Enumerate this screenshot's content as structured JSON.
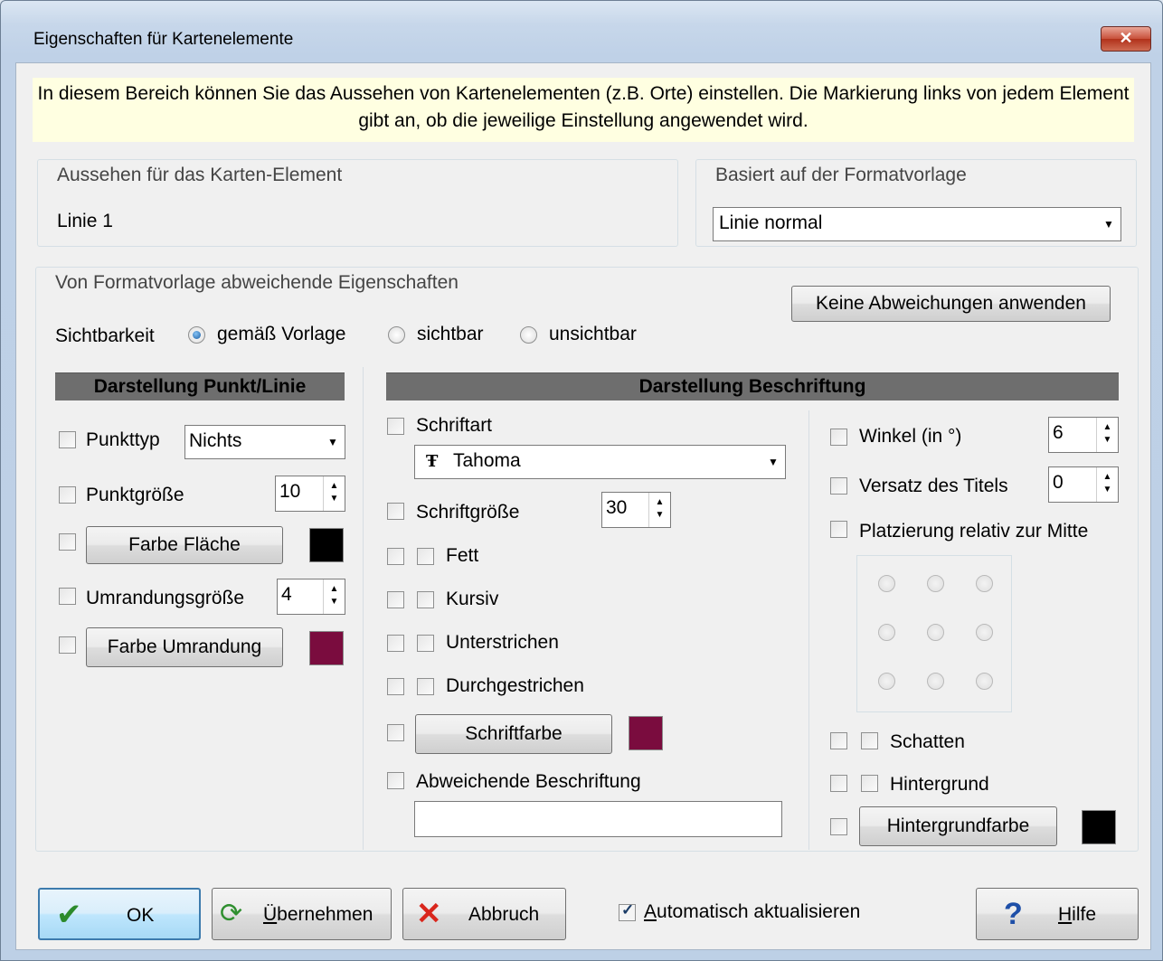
{
  "window": {
    "title": "Eigenschaften für Kartenelemente",
    "close_glyph": "✕"
  },
  "info_text": "In diesem Bereich können Sie das Aussehen von Kartenelementen (z.B. Orte) einstellen. Die Markierung links von jedem Element gibt an, ob die jeweilige Einstellung angewendet wird.",
  "appearance": {
    "group_title": "Aussehen für das Karten-Element",
    "element_name": "Linie 1"
  },
  "template": {
    "group_title": "Basiert auf der Formatvorlage",
    "selected": "Linie normal"
  },
  "deviating": {
    "group_title": "Von Formatvorlage abweichende Eigenschaften",
    "reset_button": "Keine Abweichungen anwenden",
    "visibility_label": "Sichtbarkeit",
    "visibility_options": [
      "gemäß Vorlage",
      "sichtbar",
      "unsichtbar"
    ],
    "visibility_selected": "gemäß Vorlage"
  },
  "point_line": {
    "header": "Darstellung Punkt/Linie",
    "point_type_label": "Punkttyp",
    "point_type_value": "Nichts",
    "point_size_label": "Punktgröße",
    "point_size_value": "10",
    "fill_color_button": "Farbe Fläche",
    "fill_color": "#000000",
    "border_size_label": "Umrandungsgröße",
    "border_size_value": "4",
    "border_color_button": "Farbe Umrandung",
    "border_color": "#7a0c3e"
  },
  "label": {
    "header": "Darstellung Beschriftung",
    "font_label": "Schriftart",
    "font_icon": "Ŧ",
    "font_value": "Tahoma",
    "font_size_label": "Schriftgröße",
    "font_size_value": "30",
    "bold": "Fett",
    "italic": "Kursiv",
    "underline": "Unterstrichen",
    "strikethrough": "Durchgestrichen",
    "font_color_button": "Schriftfarbe",
    "font_color": "#7a0c3e",
    "custom_label": "Abweichende Beschriftung",
    "custom_value": "",
    "angle_label": "Winkel (in °)",
    "angle_value": "6",
    "offset_label": "Versatz des Titels",
    "offset_value": "0",
    "placement_label": "Platzierung relativ zur Mitte",
    "shadow": "Schatten",
    "background": "Hintergrund",
    "bg_color_button": "Hintergrundfarbe",
    "bg_color": "#000000"
  },
  "footer": {
    "ok": "OK",
    "apply_prefix": "",
    "apply_u": "Ü",
    "apply_rest": "bernehmen",
    "cancel": "Abbruch",
    "auto_update_u": "A",
    "auto_update_rest": "utomatisch aktualisieren",
    "auto_update_checked": true,
    "help_u": "H",
    "help_rest": "ilfe"
  }
}
